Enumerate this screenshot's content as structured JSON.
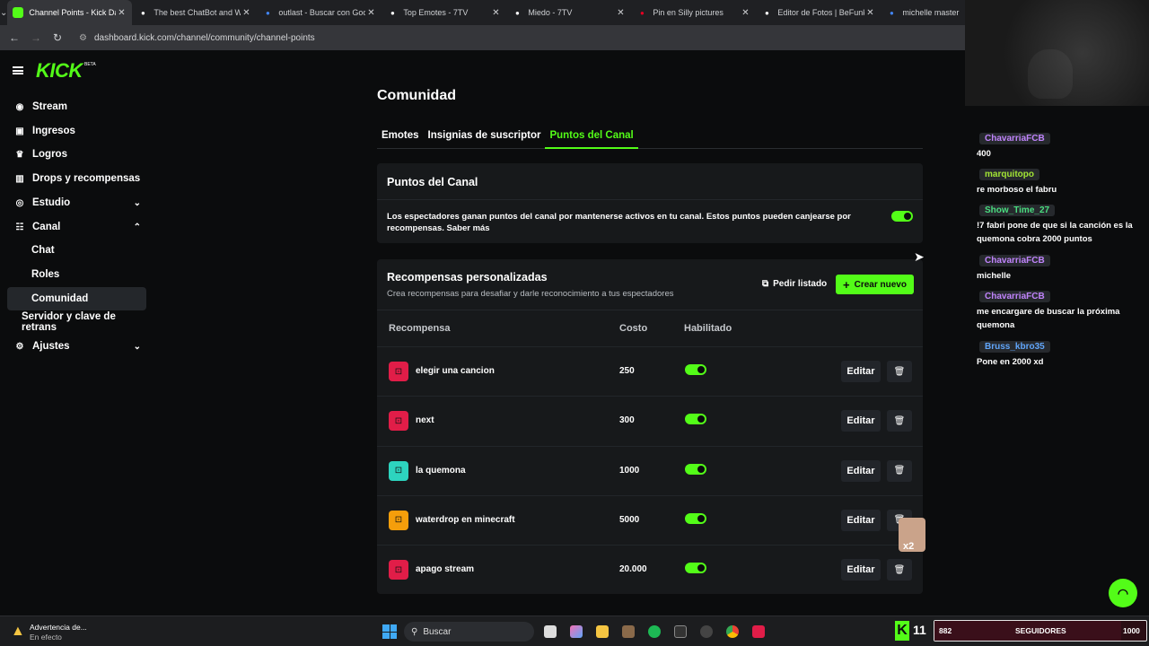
{
  "browser": {
    "tabs": [
      {
        "title": "Channel Points - Kick Das",
        "icon": "kick-favicon",
        "color": "#53fc18",
        "active": true
      },
      {
        "title": "The best ChatBot and Wi",
        "icon": "diamond-favicon",
        "color": "#ffffff",
        "active": false
      },
      {
        "title": "outlast - Buscar con Goog",
        "icon": "google-favicon",
        "color": "#4285f4",
        "active": false
      },
      {
        "title": "Top Emotes - 7TV",
        "icon": "7tv-favicon",
        "color": "#ffffff",
        "active": false
      },
      {
        "title": "Miedo - 7TV",
        "icon": "7tv-favicon",
        "color": "#ffffff",
        "active": false
      },
      {
        "title": "Pin en Silly pictures",
        "icon": "pinterest-favicon",
        "color": "#e60023",
        "active": false
      },
      {
        "title": "Editor de Fotos | BeFunky",
        "icon": "befunky-favicon",
        "color": "#ffffff",
        "active": false
      },
      {
        "title": "michelle master",
        "icon": "google-favicon",
        "color": "#4285f4",
        "active": false
      }
    ],
    "url": "dashboard.kick.com/channel/community/channel-points"
  },
  "sidebar": {
    "logo": "KICK",
    "beta": "BETA",
    "items": [
      {
        "label": "Stream",
        "icon": "stream-icon",
        "glyph": "((•))"
      },
      {
        "label": "Ingresos",
        "icon": "revenue-icon",
        "glyph": "▣"
      },
      {
        "label": "Logros",
        "icon": "trophy-icon",
        "glyph": "🏆"
      },
      {
        "label": "Drops y recompensas",
        "icon": "gift-icon",
        "glyph": "▥"
      },
      {
        "label": "Estudio",
        "icon": "studio-icon",
        "glyph": "◉",
        "chevron": "⌄"
      },
      {
        "label": "Canal",
        "icon": "channel-icon",
        "glyph": "☷",
        "chevron": "⌃"
      }
    ],
    "sub_items": [
      "Chat",
      "Roles",
      "Comunidad"
    ],
    "extra": "Servidor y clave de retrans",
    "settings": "Ajustes"
  },
  "main": {
    "title": "Comunidad",
    "tabs": [
      "Emotes",
      "Insignias de suscriptor",
      "Puntos del Canal"
    ],
    "points_card": {
      "title": "Puntos del Canal",
      "description_line1": "Los espectadores ganan puntos del canal por mantenerse activos en tu canal. Estos puntos pueden canjearse por",
      "description_line2": "recompensas. Saber más",
      "enabled": true
    },
    "rewards_card": {
      "title": "Recompensas personalizadas",
      "subtitle": "Crea recompensas para desafiar y darle reconocimiento a tus espectadores",
      "export_label": "Pedir listado",
      "create_label": "Crear nuevo",
      "columns": [
        "Recompensa",
        "Costo",
        "Habilitado"
      ],
      "edit_label": "Editar",
      "rows": [
        {
          "name": "elegir una cancion",
          "cost": "250",
          "color": "#e11d48",
          "enabled": true
        },
        {
          "name": "next",
          "cost": "300",
          "color": "#e11d48",
          "enabled": true
        },
        {
          "name": "la quemona",
          "cost": "1000",
          "color": "#2dd4bf",
          "enabled": true
        },
        {
          "name": "waterdrop en minecraft",
          "cost": "5000",
          "color": "#f59e0b",
          "enabled": true
        },
        {
          "name": "apago stream",
          "cost": "20.000",
          "color": "#e11d48",
          "enabled": true
        }
      ]
    }
  },
  "chat": {
    "messages": [
      {
        "user": "ChavarriaFCB",
        "user_color": "#c084fc",
        "text": "400"
      },
      {
        "user": "marquitopo",
        "user_color": "#a3e635",
        "text": "re morboso el fabru"
      },
      {
        "user": "Show_Time_27",
        "user_color": "#4ade80",
        "text": "!7 fabri pone de que si la canción es la quemona cobra 2000 puntos"
      },
      {
        "user": "ChavarriaFCB",
        "user_color": "#c084fc",
        "text": "michelle"
      },
      {
        "user": "ChavarriaFCB",
        "user_color": "#c084fc",
        "text": "me encargare de buscar la próxima quemona"
      },
      {
        "user": "Bruss_kbro35",
        "user_color": "#60a5fa",
        "text": "Pone en 2000 xd"
      }
    ]
  },
  "overlay": {
    "multiplier": "x2",
    "follower_count": "11",
    "followers_current": "882",
    "followers_label": "SEGUIDORES",
    "followers_goal": "1000"
  },
  "taskbar": {
    "warning_title": "Advertencia de...",
    "warning_sub": "En efecto",
    "search": "Buscar"
  }
}
